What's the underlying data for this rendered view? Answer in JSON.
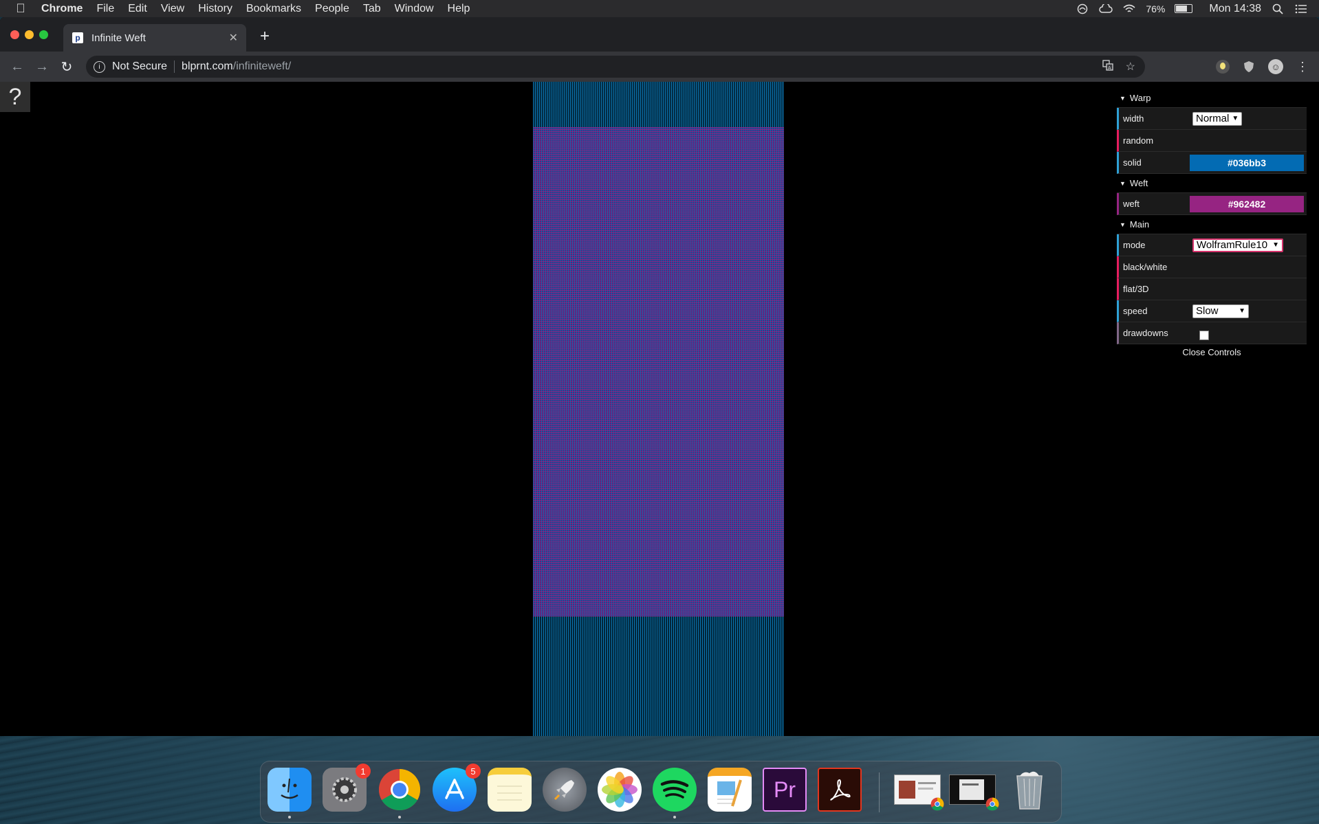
{
  "menubar": {
    "app_name": "Chrome",
    "items": [
      "File",
      "Edit",
      "View",
      "History",
      "Bookmarks",
      "People",
      "Tab",
      "Window",
      "Help"
    ],
    "battery_percent": "76%",
    "clock": "Mon 14:38"
  },
  "browser": {
    "tab_title": "Infinite Weft",
    "favicon_letter": "p",
    "security_label": "Not Secure",
    "url_host": "blprnt.com",
    "url_path": "/infiniteweft/"
  },
  "page": {
    "help_glyph": "?"
  },
  "controls": {
    "warp": {
      "title": "Warp",
      "width_label": "width",
      "width_value": "Normal",
      "random_label": "random",
      "solid_label": "solid",
      "solid_color": "#036bb3"
    },
    "weft": {
      "title": "Weft",
      "weft_label": "weft",
      "weft_color": "#962482"
    },
    "main": {
      "title": "Main",
      "mode_label": "mode",
      "mode_value": "WolframRule10",
      "bw_label": "black/white",
      "flat_label": "flat/3D",
      "speed_label": "speed",
      "speed_value": "Slow",
      "drawdowns_label": "drawdowns",
      "drawdowns_checked": false
    },
    "close_label": "Close Controls"
  },
  "dock": {
    "apps": [
      {
        "name": "Finder",
        "icon": "finder-icon",
        "running": true
      },
      {
        "name": "System Preferences",
        "icon": "gear-icon",
        "badge": "1"
      },
      {
        "name": "Google Chrome",
        "icon": "chrome-icon",
        "running": true
      },
      {
        "name": "App Store",
        "icon": "app-store-icon",
        "badge": "5"
      },
      {
        "name": "Notes",
        "icon": "notes-icon"
      },
      {
        "name": "Launchpad",
        "icon": "rocket-icon"
      },
      {
        "name": "Photos",
        "icon": "photos-icon"
      },
      {
        "name": "Spotify",
        "icon": "spotify-icon",
        "running": true
      },
      {
        "name": "Pages",
        "icon": "pages-icon"
      },
      {
        "name": "Premiere Pro",
        "icon": "premiere-icon",
        "label": "Pr"
      },
      {
        "name": "Acrobat",
        "icon": "acrobat-icon"
      },
      {
        "name": "Chrome Window 1",
        "icon": "chrome-window-thumbnail"
      },
      {
        "name": "Chrome Window 2",
        "icon": "chrome-window-thumbnail"
      },
      {
        "name": "Trash",
        "icon": "trash-icon"
      }
    ]
  },
  "colors": {
    "warp_blue": "#036bb3",
    "weft_purple": "#962482",
    "gui_number": "#2fa1d6",
    "gui_function": "#e61d5f"
  }
}
